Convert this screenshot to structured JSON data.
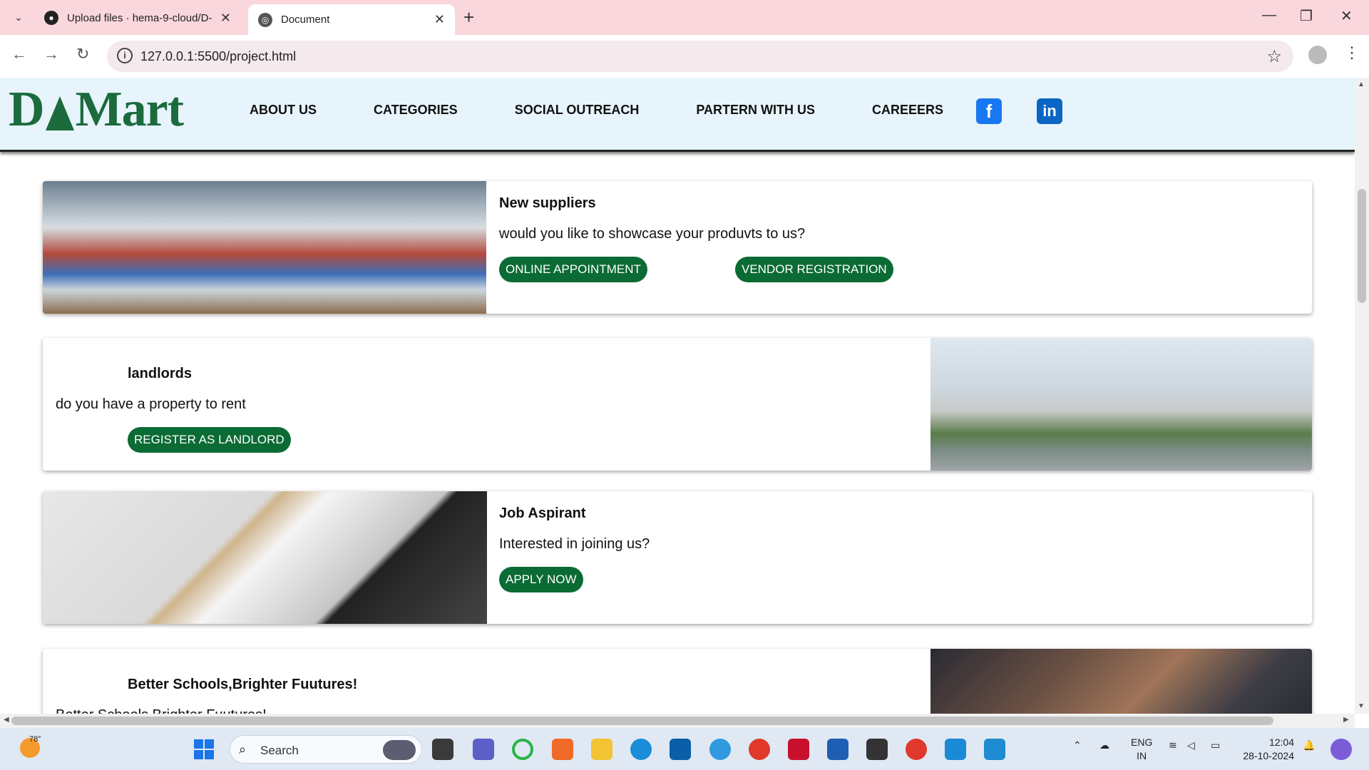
{
  "browser": {
    "tabs": [
      {
        "title": "Upload files · hema-9-cloud/D-",
        "active": false
      },
      {
        "title": "Document",
        "active": true
      }
    ],
    "url": "127.0.0.1:5500/project.html"
  },
  "site": {
    "logo": "DMart",
    "nav": [
      "ABOUT US",
      "CATEGORIES",
      "SOCIAL OUTREACH",
      "PARTERN WITH US",
      "CAREEERS"
    ],
    "social": [
      {
        "name": "facebook",
        "glyph": "f"
      },
      {
        "name": "linkedin",
        "glyph": "in"
      }
    ]
  },
  "cards": [
    {
      "heading": "New suppliers",
      "description": "would you like to showcase your produvts to us?",
      "buttons": [
        "ONLINE APPOINTMENT",
        "VENDOR REGISTRATION"
      ],
      "image": "store-interior"
    },
    {
      "heading": "landlords",
      "description": "do you have a property to rent",
      "buttons": [
        "REGISTER AS LANDLORD"
      ],
      "image": "dmart-building"
    },
    {
      "heading": "Job Aspirant",
      "description": "Interested in joining us?",
      "buttons": [
        "APPLY NOW"
      ],
      "image": "resume-desk"
    },
    {
      "heading": "Better Schools,Brighter Fuutures!",
      "description": "Better Schools,Brighter Fuutures!",
      "buttons": [],
      "image": "joined-hands"
    }
  ],
  "taskbar": {
    "weather_temp": "78°",
    "search_placeholder": "Search",
    "lang_line1": "ENG",
    "lang_line2": "IN",
    "time": "12:04",
    "date": "28-10-2024"
  },
  "colors": {
    "brand_green": "#0b6b34",
    "header_bg": "#e7f4fb",
    "tabbar_bg": "#f9d7dc"
  }
}
